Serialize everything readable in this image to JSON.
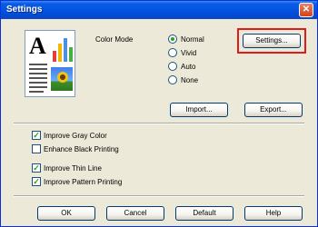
{
  "window": {
    "title": "Settings",
    "close_glyph": "✕"
  },
  "preview": {
    "glyph": "A"
  },
  "color_mode": {
    "label": "Color Mode",
    "options": [
      {
        "label": "Normal",
        "selected": true
      },
      {
        "label": "Vivid",
        "selected": false
      },
      {
        "label": "Auto",
        "selected": false
      },
      {
        "label": "None",
        "selected": false
      }
    ]
  },
  "buttons": {
    "settings": "Settings...",
    "import": "Import...",
    "export": "Export...",
    "ok": "OK",
    "cancel": "Cancel",
    "default": "Default",
    "help": "Help"
  },
  "checkboxes": [
    {
      "label": "Improve Gray Color",
      "checked": true
    },
    {
      "label": "Enhance Black Printing",
      "checked": false
    },
    {
      "label": "Improve Thin Line",
      "checked": true
    },
    {
      "label": "Improve Pattern Printing",
      "checked": true
    }
  ],
  "check_glyph": "✓",
  "colors": {
    "titlebar": "#0454e3",
    "highlight": "#e01b1b",
    "face": "#ece9d8"
  }
}
